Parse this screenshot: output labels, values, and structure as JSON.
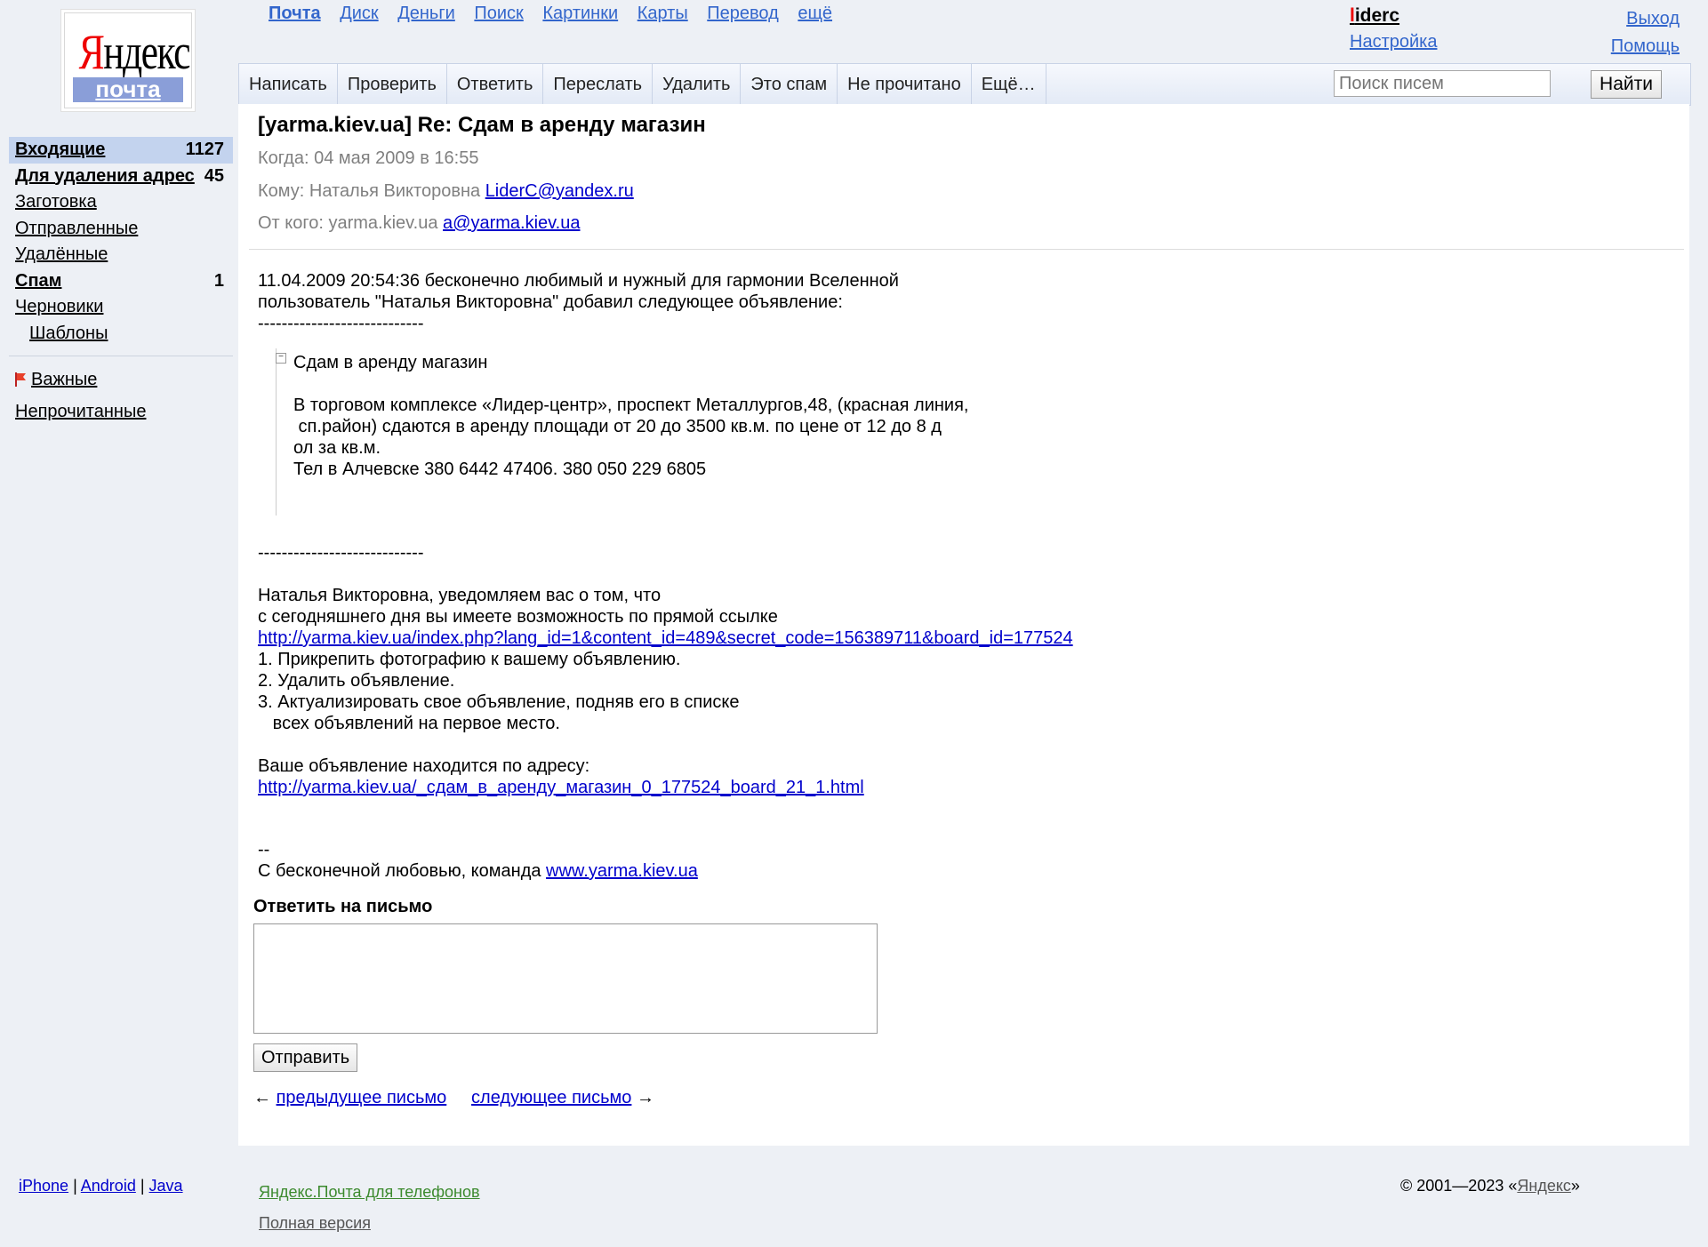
{
  "logo": {
    "word_first": "Я",
    "word_rest": "ндекс",
    "sub": "почта"
  },
  "topnav": [
    "Почта",
    "Диск",
    "Деньги",
    "Поиск",
    "Картинки",
    "Карты",
    "Перевод",
    "ещё"
  ],
  "user": {
    "name_first": "l",
    "name_rest": "iderc",
    "settings": "Настройка",
    "logout": "Выход",
    "help": "Помощь"
  },
  "toolbar": {
    "buttons": [
      "Написать",
      "Проверить",
      "Ответить",
      "Переслать",
      "Удалить",
      "Это спам",
      "Не прочитано",
      "Ещё…"
    ],
    "search_placeholder": "Поиск писем",
    "search_button": "Найти"
  },
  "sidebar": {
    "folders": [
      {
        "label": "Входящие",
        "count": "1127"
      },
      {
        "label": "Для удаления адрес",
        "count": "45"
      },
      {
        "label": "Заготовка",
        "count": ""
      },
      {
        "label": "Отправленные",
        "count": ""
      },
      {
        "label": "Удалённые",
        "count": ""
      },
      {
        "label": "Спам",
        "count": "1"
      },
      {
        "label": "Черновики",
        "count": ""
      },
      {
        "label": "Шаблоны",
        "count": ""
      }
    ],
    "important": "Важные",
    "unread": "Непрочитанные"
  },
  "message": {
    "subject": "[yarma.kiev.ua] Re: Сдам в аренду магазин",
    "when_label": "Когда:",
    "when_value": "04 мая 2009 в 16:55",
    "to_label": "Кому:",
    "to_name": "Наталья Викторовна",
    "to_email": "LiderC@yandex.ru",
    "from_label": "От кого:",
    "from_name": "yarma.kiev.ua",
    "from_email": "a@yarma.kiev.ua",
    "intro": "11.04.2009 20:54:36 бесконечно любимый и нужный для гармонии Вселенной\nпользователь \"Наталья Викторовна\" добавил следующее объявление:\n----------------------------",
    "quote_title": "Сдам в аренду магазин",
    "quote_body": "В торговом комплексе «Лидер-центр», проспект Металлургов,48, (красная линия,\n сп.район) сдаются в аренду площади от 20 до 3500 кв.м. по цене от 12 до 8 д\nол за кв.м.\nТел в Алчевске 380 6442 47406. 380 050 229 6805",
    "separator": "----------------------------",
    "notice": "Наталья Викторовна, уведомляем вас о том, что\nс сегодняшнего дня вы имеете возможность по прямой ссылке",
    "link1": "http://yarma.kiev.ua/index.php?lang_id=1&content_id=489&secret_code=156389711&board_id=177524",
    "list": "1. Прикрепить фотографию к вашему объявлению.\n2. Удалить объявление.\n3. Актуализировать свое объявление, подняв его в списке\n   всех объявлений на первое место.",
    "address_label": "Ваше объявление находится по адресу:",
    "link2": "http://yarma.kiev.ua/_сдам_в_аренду_магазин_0_177524_board_21_1.html",
    "sig_dash": "--",
    "sig_text": "С бесконечной любовью, команда ",
    "sig_link": "www.yarma.kiev.ua"
  },
  "reply": {
    "title": "Ответить на письмо",
    "send": "Отправить"
  },
  "pager": {
    "prev_arrow": "←",
    "prev": "предыдущее письмо",
    "next": "следующее письмо",
    "next_arrow": "→"
  },
  "footer": {
    "iphone": "iPhone",
    "sep": "|",
    "android": "Android",
    "java": "Java",
    "mobile": "Яндекс.Почта для телефонов",
    "full": "Полная версия",
    "copyright_pre": "© 2001—2023 «",
    "copyright_link": "Яндекс",
    "copyright_post": "»"
  },
  "colors": {
    "accent": "#3366cc",
    "brand_red": "#ee0000",
    "active_folder": "#c3d3ee",
    "flag": "#e8402a"
  }
}
